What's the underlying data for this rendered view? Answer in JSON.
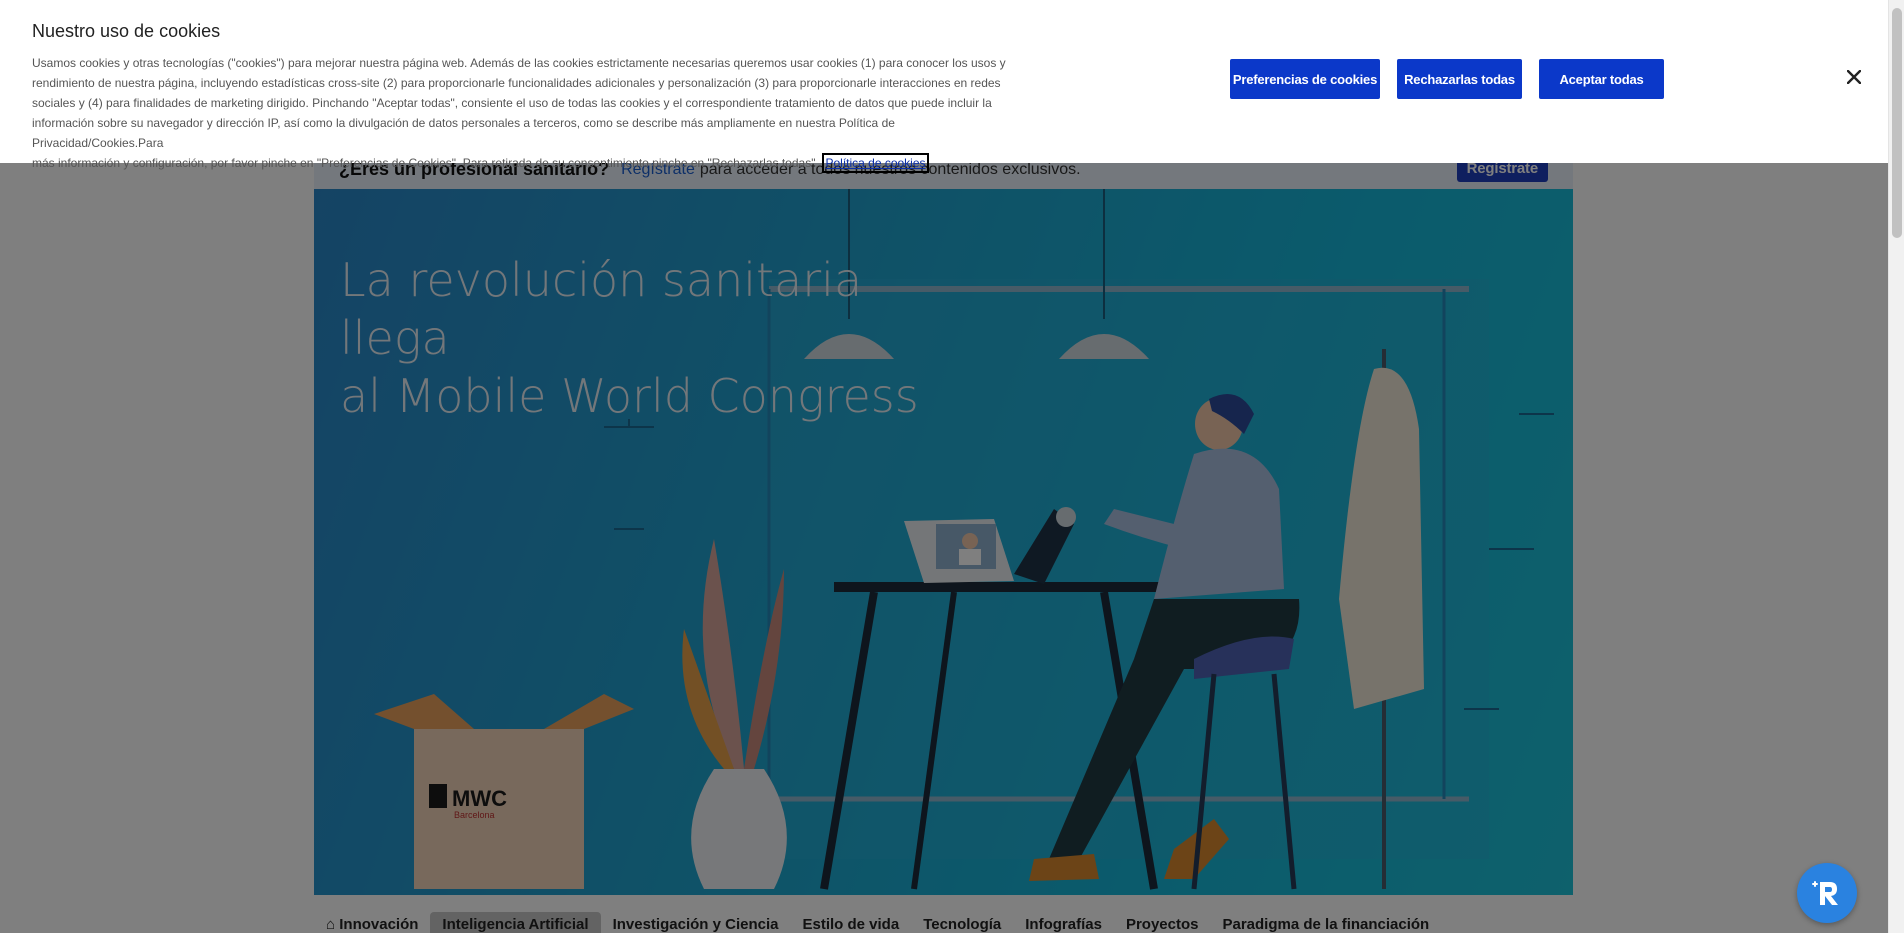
{
  "professional_bar": {
    "question": "¿Eres un profesional sanitario?",
    "link_label": "Regístrate",
    "text": "para acceder a todos nuestros contenidos exclusivos.",
    "button_label": "Regístrate"
  },
  "hero": {
    "title_line1": "La revolución sanitaria llega",
    "title_line2": "al Mobile World Congress",
    "box_logo": "MWC",
    "box_logo_sub": "Barcelona"
  },
  "nav": {
    "items": [
      {
        "label": "Innovación"
      },
      {
        "label": "Inteligencia Artificial"
      },
      {
        "label": "Investigación y Ciencia"
      },
      {
        "label": "Estilo de vida"
      },
      {
        "label": "Tecnología"
      },
      {
        "label": "Infografías"
      },
      {
        "label": "Proyectos"
      },
      {
        "label": "Paradigma de la financiación"
      }
    ]
  },
  "cookie_banner": {
    "title": "Nuestro uso de cookies",
    "body_line1": "Usamos cookies y otras tecnologías (\"cookies\") para mejorar nuestra página web. Además de las cookies estrictamente necesarias queremos usar cookies (1) para conocer los usos y",
    "body_line2": "rendimiento de nuestra página, incluyendo estadísticas cross-site (2) para proporcionarle funcionalidades adicionales y personalización (3) para proporcionarle interacciones en redes",
    "body_line3": "sociales y (4) para finalidades de marketing dirigido. Pinchando \"Aceptar todas\", consiente el uso de todas las cookies y el correspondiente tratamiento de datos que puede incluir la",
    "body_line4": "información sobre su navegador y dirección IP, así como la divulgación de datos personales a terceros, como se describe más ampliamente en nuestra Política de Privacidad/Cookies.Para",
    "body_line5": "más información y configuración, por favor pinche en \"Preferencias de Cookies\". Para retirada de su consentimiento pinche en \"Rechazarlas todas\".",
    "policy_link": "Política de cookies",
    "prefs_button": "Preferencias de cookies",
    "reject_button": "Rechazarlas todas",
    "accept_button": "Aceptar todas"
  },
  "colors": {
    "primary_button": "#0b38c9",
    "fab": "#2a82e0"
  }
}
